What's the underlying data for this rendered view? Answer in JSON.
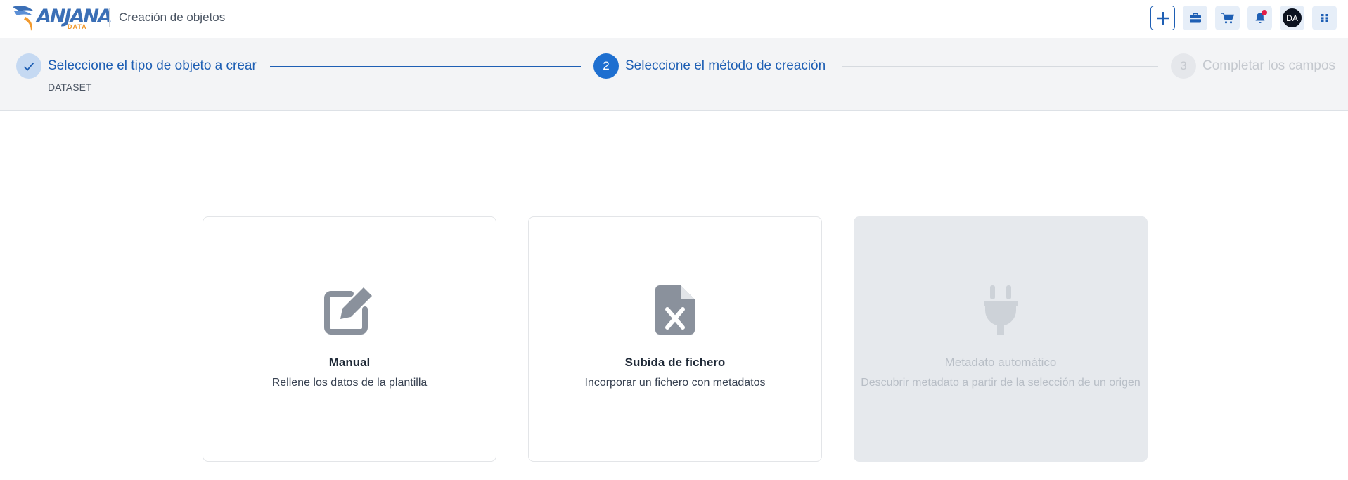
{
  "header": {
    "logo_text": "ANJANA",
    "logo_sub": "DATA",
    "title": "Creación de objetos",
    "avatar_initials": "DA",
    "icons": [
      "plus-icon",
      "briefcase-icon",
      "cart-icon",
      "bell-icon",
      "grid-icon"
    ]
  },
  "stepper": {
    "steps": [
      {
        "number": "1",
        "label": "Seleccione el tipo de objeto a crear",
        "sub": "DATASET",
        "state": "completed"
      },
      {
        "number": "2",
        "label": "Seleccione el método de creación",
        "state": "active"
      },
      {
        "number": "3",
        "label": "Completar los campos",
        "state": "pending"
      }
    ]
  },
  "cards": [
    {
      "title": "Manual",
      "description": "Rellene los datos de la plantilla",
      "icon": "edit-icon",
      "enabled": true
    },
    {
      "title": "Subida de fichero",
      "description": "Incorporar un fichero con metadatos",
      "icon": "file-excel-icon",
      "enabled": true
    },
    {
      "title": "Metadato automático",
      "description": "Descubrir metadato a partir de la selección de un origen",
      "icon": "plug-icon",
      "enabled": false
    }
  ],
  "colors": {
    "primary": "#1e5fb4",
    "accent": "#1e6fd0",
    "logo_blue": "#3b6fb6",
    "logo_orange": "#f29a2e",
    "notification": "#e11d48",
    "disabled_bg": "#e6e9ed"
  }
}
